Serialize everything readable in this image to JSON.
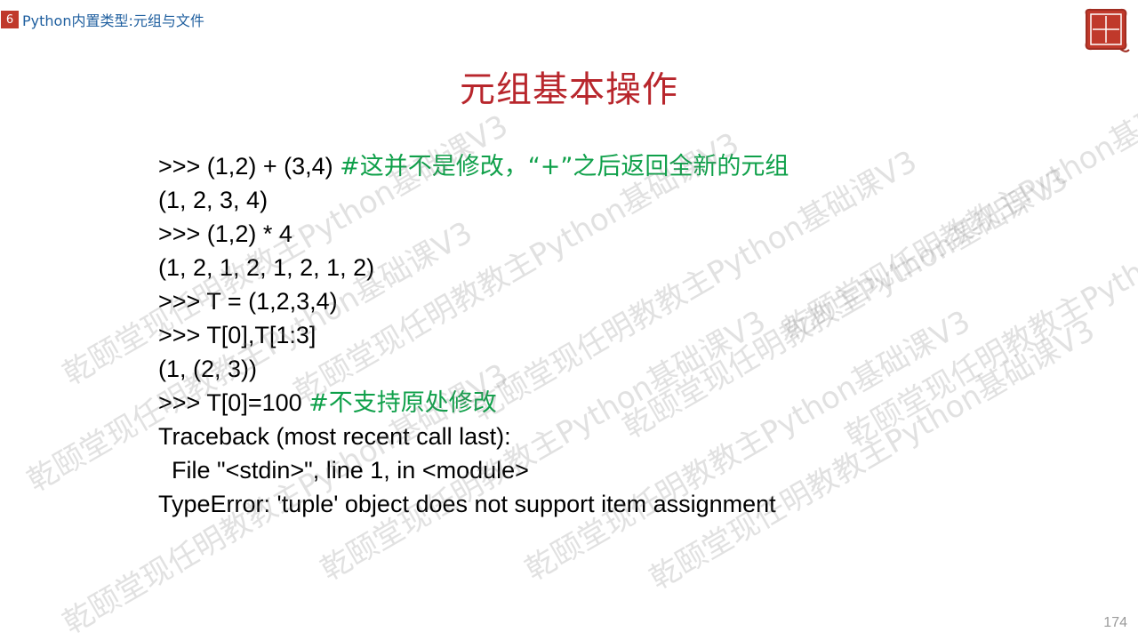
{
  "header": {
    "chapter_number": "6",
    "section_title": "Python内置类型:元组与文件"
  },
  "logo": {
    "name": "seal-logo-icon",
    "color": "#c0392b"
  },
  "slide": {
    "title": "元组基本操作",
    "lines": [
      {
        "code": ">>> (1,2) + (3,4) ",
        "comment": "#这并不是修改，“+”之后返回全新的元组"
      },
      {
        "code": "(1, 2, 3, 4)",
        "comment": ""
      },
      {
        "code": ">>> (1,2) * 4",
        "comment": ""
      },
      {
        "code": "(1, 2, 1, 2, 1, 2, 1, 2)",
        "comment": ""
      },
      {
        "code": ">>> T = (1,2,3,4)",
        "comment": ""
      },
      {
        "code": ">>> T[0],T[1:3]",
        "comment": ""
      },
      {
        "code": "(1, (2, 3))",
        "comment": ""
      },
      {
        "code": ">>> T[0]=100 ",
        "comment": "#不支持原处修改"
      },
      {
        "code": "Traceback (most recent call last):",
        "comment": ""
      },
      {
        "code": "  File \"<stdin>\", line 1, in <module>",
        "comment": ""
      },
      {
        "code": "TypeError: 'tuple' object does not support item assignment",
        "comment": ""
      }
    ]
  },
  "page_number": "174",
  "watermark_text": "乾颐堂现任明教教主Python基础课V3",
  "colors": {
    "title": "#b8262c",
    "comment": "#0fa04a",
    "header_text": "#1f5f9f",
    "badge": "#c0392b"
  }
}
